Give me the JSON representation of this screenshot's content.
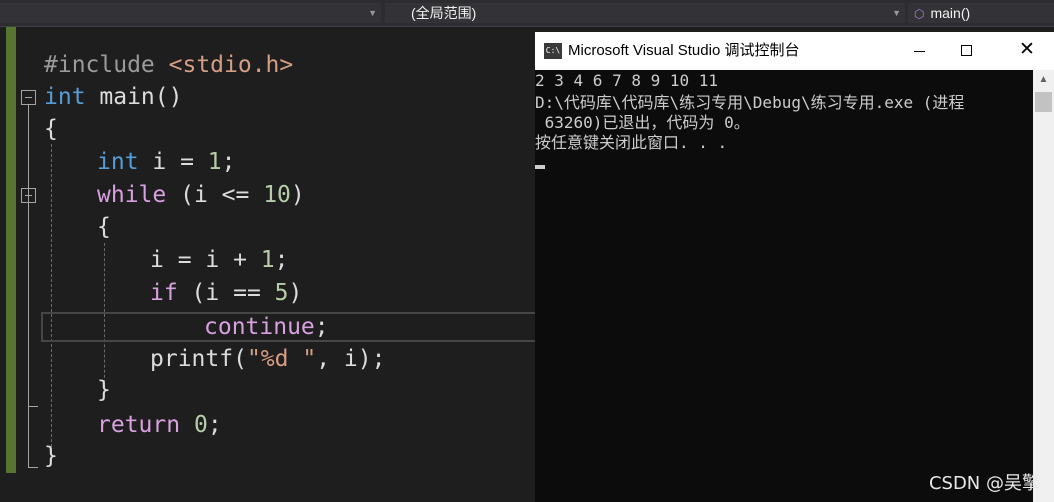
{
  "navbar": {
    "scope_label": "(全局范围)",
    "function_label": "main()"
  },
  "editor": {
    "lines": {
      "l1": {
        "a": "#include ",
        "b": "<stdio.h>"
      },
      "l2": {
        "a": "int",
        "b": " main()"
      },
      "l3": "{",
      "l4": {
        "a": "int",
        "b": " i = ",
        "c": "1",
        "d": ";"
      },
      "l5": {
        "a": "while",
        "b": " (i <= ",
        "c": "10",
        "d": ")"
      },
      "l6": "{",
      "l7": {
        "a": "i = i + ",
        "b": "1",
        "c": ";"
      },
      "l8": {
        "a": "if",
        "b": " (i == ",
        "c": "5",
        "d": ")"
      },
      "l9": {
        "a": "continue",
        "b": ";"
      },
      "l10": {
        "a": "printf(",
        "b": "\"%d \"",
        "c": ", i);"
      },
      "l11": "}",
      "l12": {
        "a": "return",
        "b": " ",
        "c": "0",
        "d": ";"
      },
      "l13": "}"
    }
  },
  "console": {
    "icon_text": "C:\\",
    "title": "Microsoft Visual Studio 调试控制台",
    "output": [
      "2 3 4 6 7 8 9 10 11",
      "D:\\代码库\\代码库\\练习专用\\Debug\\练习专用.exe (进程",
      " 63260)已退出，代码为 0。",
      "按任意键关闭此窗口. . ."
    ],
    "close_glyph": "✕"
  },
  "watermark": "CSDN @吴擎",
  "colors": {
    "editor_bg": "#1e1e1e",
    "keyword_blue": "#569cd6",
    "keyword_purple": "#d8a0df",
    "number_green": "#b5cea8",
    "string_orange": "#d69d85",
    "change_bar": "#577430",
    "console_bg": "#0c0c0c"
  }
}
